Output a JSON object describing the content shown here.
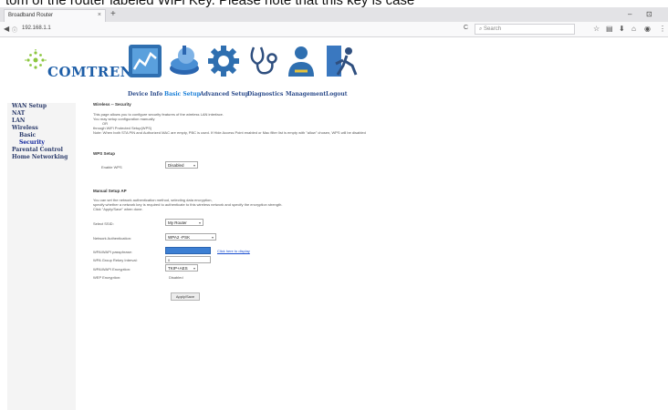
{
  "caption": "tom of the router labeled WiFi Key. Please note that this key is case",
  "browser": {
    "tab_title": "Broadband Router",
    "tab_close": "×",
    "new_tab": "+",
    "url": "192.168.1.1",
    "search_placeholder": "Search",
    "reload": "C",
    "minimize": "–",
    "maximize": "⊡",
    "back": "◀",
    "info": "ⓘ"
  },
  "brand": {
    "name": "COMTREND"
  },
  "top_menu": [
    {
      "label": "Device Info",
      "icon": "device-info-icon"
    },
    {
      "label": "Basic Setup",
      "icon": "basic-setup-icon",
      "active": true
    },
    {
      "label": "Advanced Setup",
      "icon": "advanced-setup-icon"
    },
    {
      "label": "Diagnostics",
      "icon": "diagnostics-icon"
    },
    {
      "label": "Management",
      "icon": "management-icon"
    },
    {
      "label": "Logout",
      "icon": "logout-icon"
    }
  ],
  "sidebar": {
    "items": [
      {
        "label": "WAN Setup"
      },
      {
        "label": "NAT"
      },
      {
        "label": "LAN"
      },
      {
        "label": "Wireless"
      },
      {
        "label": "Basic",
        "sub": true
      },
      {
        "label": "Security",
        "sub": true,
        "active": true
      },
      {
        "label": "Parental Control"
      },
      {
        "label": "Home Networking"
      }
    ]
  },
  "page": {
    "title": "Wireless -- Security",
    "intro": [
      "This page allows you to configure security features of the wireless LAN interface.",
      "You may setup configuration manually",
      "OR",
      "through WiFi Protected Setup(WPS)",
      "Note: When both STA PIN and Authorized MAC are empty, PBC is used. If Hide Access Point enabled or Mac filter list is empty with \"allow\" chosen, WPS will be disabled"
    ],
    "wps": {
      "heading": "WPS Setup",
      "enable_label": "Enable WPS",
      "enable_value": "Disabled"
    },
    "manual": {
      "heading": "Manual Setup AP",
      "desc": [
        "You can set the network authentication method, selecting data encryption,",
        "specify whether a network key is required to authenticate to this wireless network and specify the encryption strength.",
        "Click \"Apply/Save\" when done."
      ],
      "ssid_label": "Select SSID:",
      "ssid_value": "My Router",
      "auth_label": "Network Authentication:",
      "auth_value": "WPA2 -PSK",
      "passphrase_label": "WPA/WAPI passphrase:",
      "passphrase_link": "Click here to display",
      "rekey_label": "WPA Group Rekey Interval:",
      "rekey_value": "0",
      "encryption_label": "WPA/WAPI Encryption:",
      "encryption_value": "TKIP+AES",
      "wep_label": "WEP Encryption:",
      "wep_value": "Disabled",
      "apply_label": "Apply/Save"
    }
  }
}
